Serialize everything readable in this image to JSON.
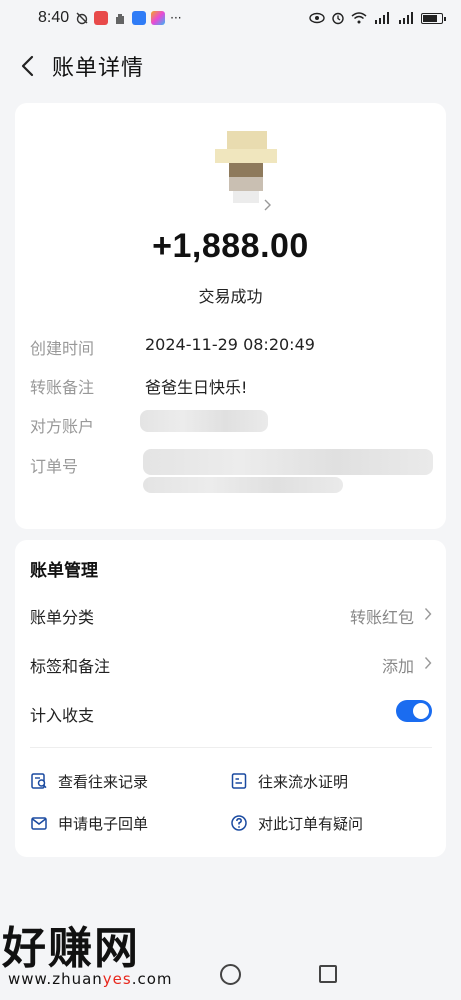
{
  "status_bar": {
    "time": "8:40",
    "more": "···"
  },
  "header": {
    "title": "账单详情"
  },
  "transaction": {
    "amount": "+1,888.00",
    "status": "交易成功",
    "details": [
      {
        "label": "创建时间",
        "value": "2024-11-29 08:20:49"
      },
      {
        "label": "转账备注",
        "value": "爸爸生日快乐!"
      },
      {
        "label": "对方账户",
        "value": ""
      },
      {
        "label": "订单号",
        "value": ""
      }
    ]
  },
  "manage": {
    "title": "账单管理",
    "category_label": "账单分类",
    "category_value": "转账红包",
    "tags_label": "标签和备注",
    "tags_value": "添加",
    "include_label": "计入收支",
    "include_enabled": true,
    "actions": {
      "records": "查看往来记录",
      "proof": "往来流水证明",
      "receipt": "申请电子回单",
      "question": "对此订单有疑问"
    }
  },
  "watermark": {
    "big": "好赚网",
    "small_pre": "www.zhuan",
    "small_accent": "yes",
    "small_post": ".com"
  },
  "colors": {
    "accent": "#1a6cf0",
    "background": "#f4f5f7",
    "label_grey": "#999999"
  }
}
